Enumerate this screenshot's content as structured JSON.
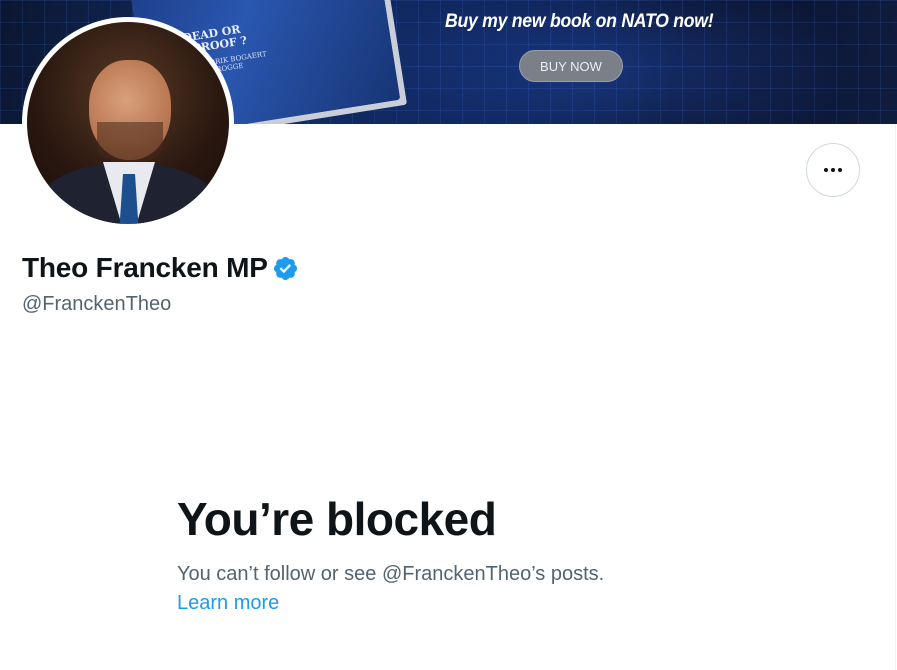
{
  "banner": {
    "book_title_lines": [
      "-DEAD OR",
      "E-PROOF ?"
    ],
    "book_authors_lines": [
      "N, HENDRIK BOGAERT",
      "ER BUYSROGGE"
    ],
    "promo_text": "Buy my new book on NATO now!",
    "buy_button_label": "BUY NOW"
  },
  "profile": {
    "display_name": "Theo Francken MP",
    "handle": "@FranckenTheo",
    "verified": true,
    "verified_color": "#1d9bf0"
  },
  "blocked": {
    "title": "You’re blocked",
    "description": "You can’t follow or see @FranckenTheo’s posts.",
    "learn_more_label": "Learn more"
  },
  "colors": {
    "text_primary": "#0f1419",
    "text_secondary": "#536471",
    "link": "#1d9bf0"
  },
  "icons": {
    "more": "more-horizontal-icon",
    "verified": "verified-badge-icon"
  }
}
